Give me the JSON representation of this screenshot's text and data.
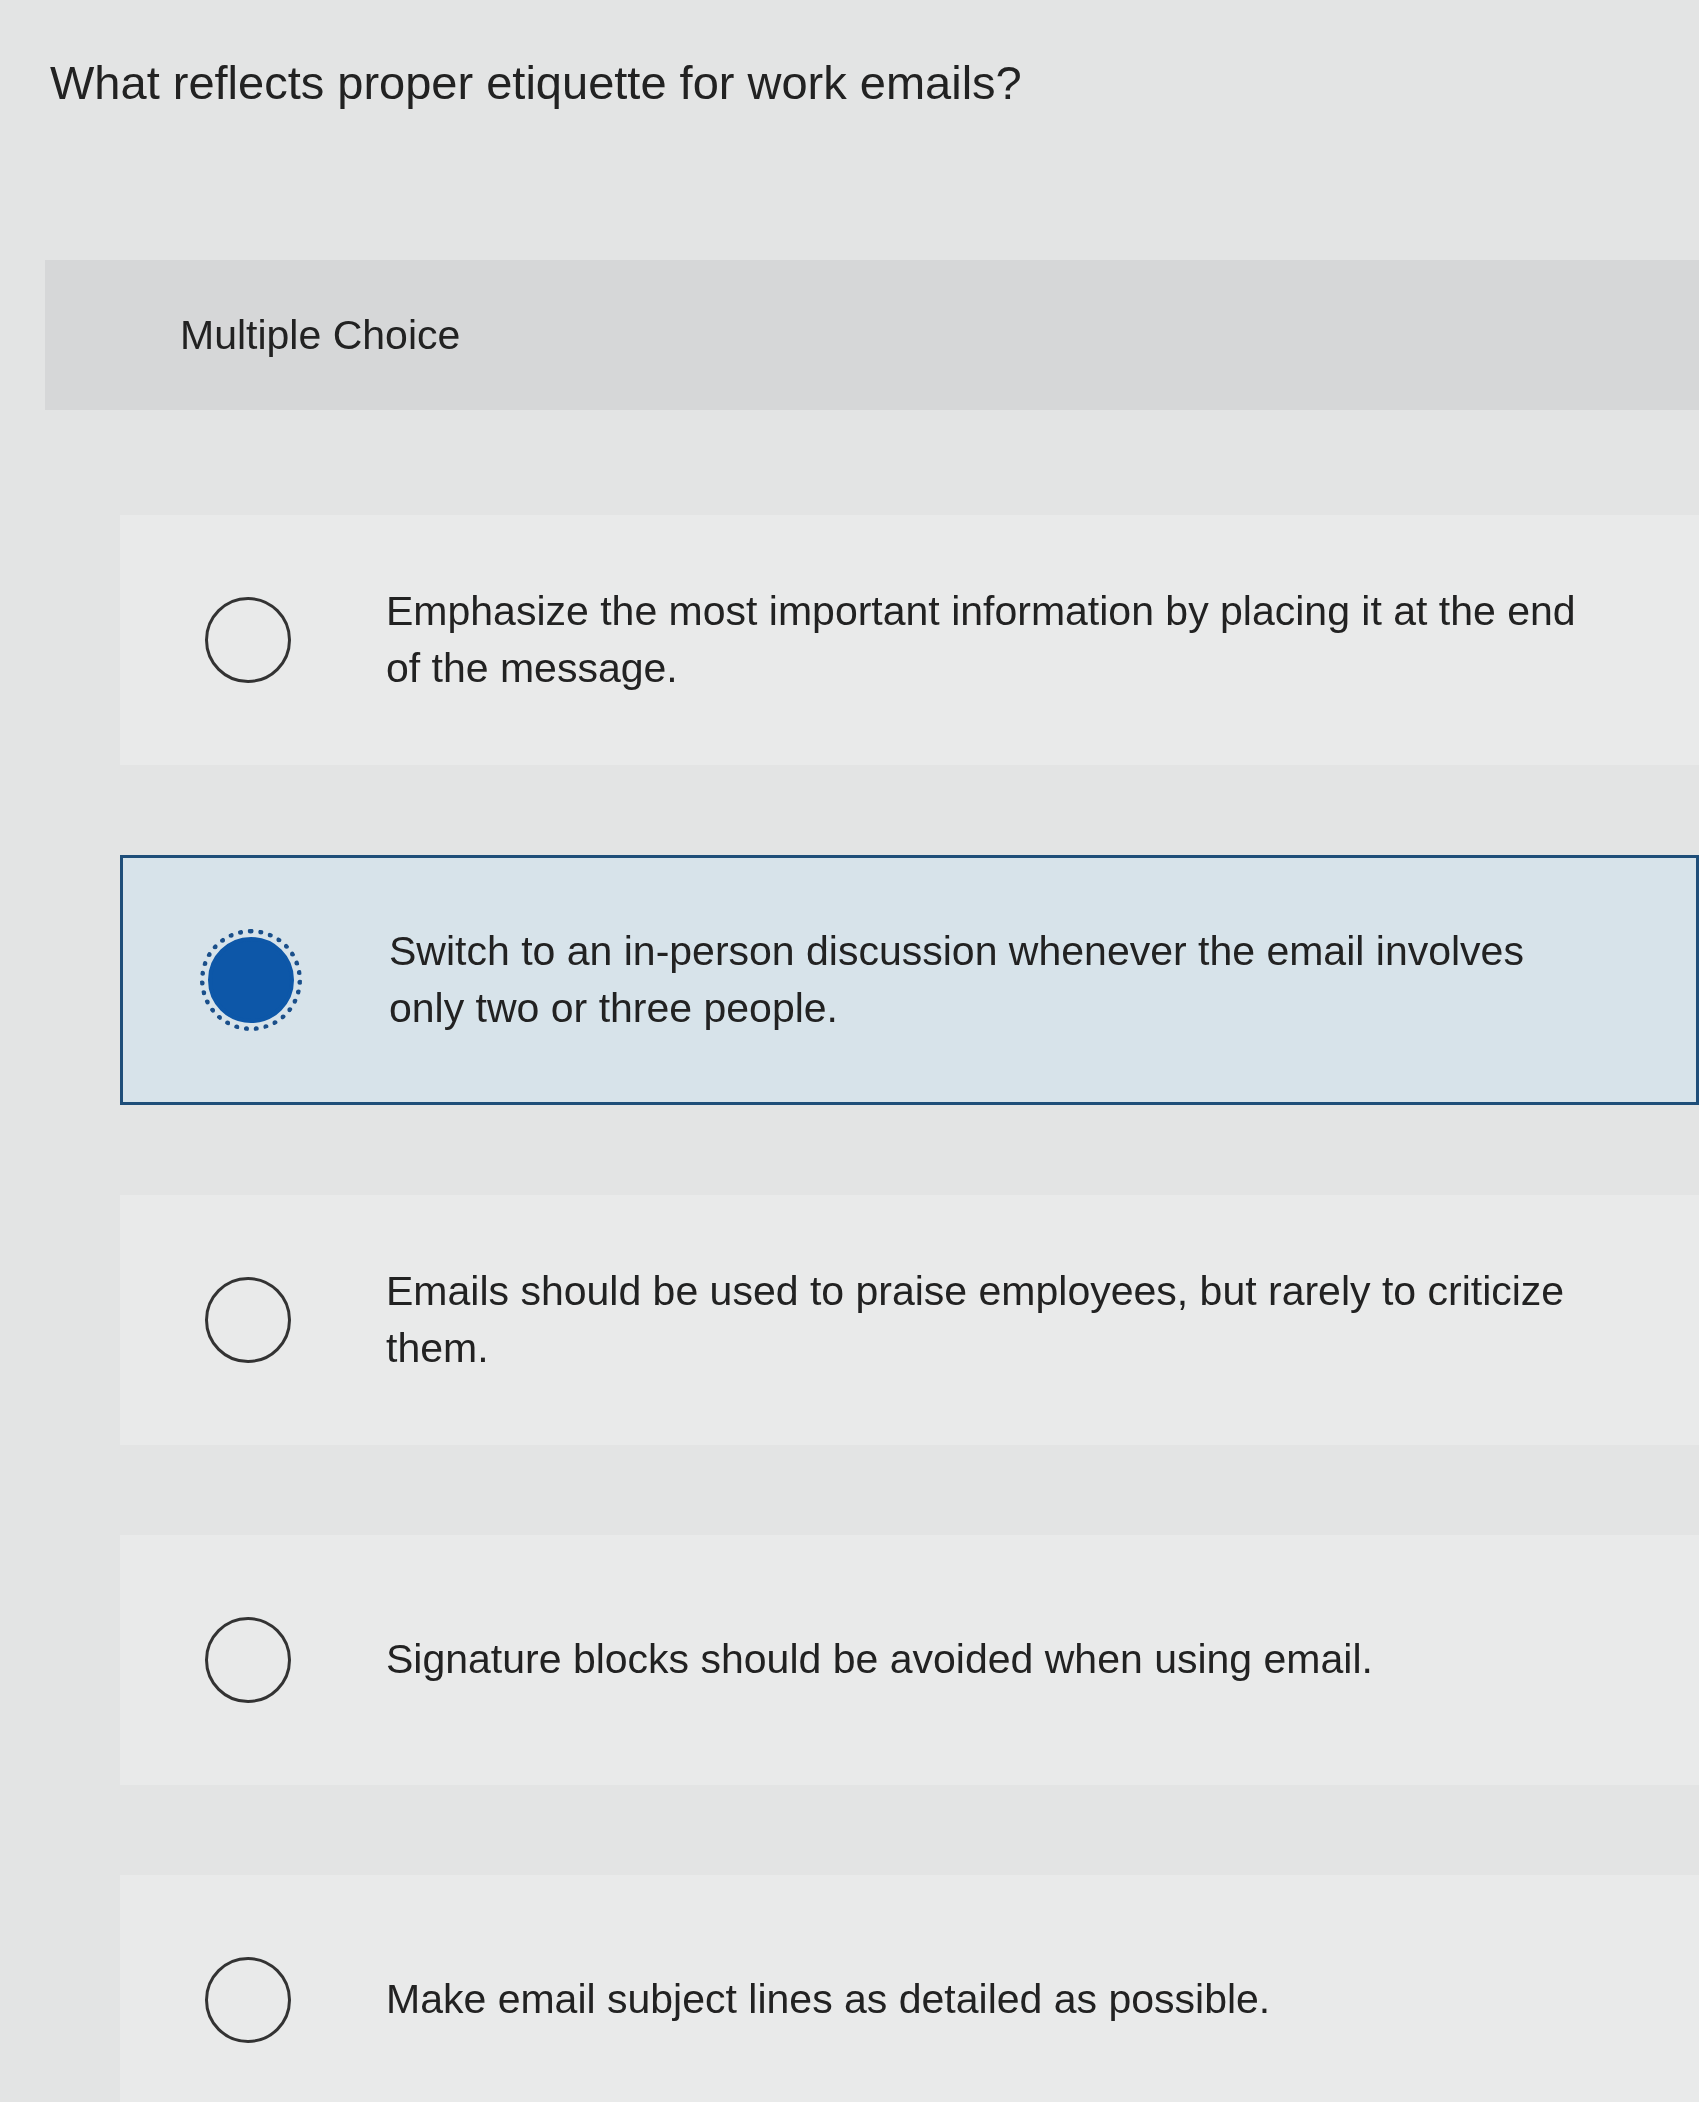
{
  "question": "What reflects proper etiquette for work emails?",
  "question_type": "Multiple Choice",
  "options": [
    {
      "text": "Emphasize the most important information by placing it at the end of the message.",
      "selected": false
    },
    {
      "text": "Switch to an in-person discussion whenever the email involves only two or three people.",
      "selected": true
    },
    {
      "text": "Emails should be used to praise employees, but rarely to criticize them.",
      "selected": false
    },
    {
      "text": "Signature blocks should be avoided when using email.",
      "selected": false
    },
    {
      "text": "Make email subject lines as detailed as possible.",
      "selected": false
    }
  ]
}
